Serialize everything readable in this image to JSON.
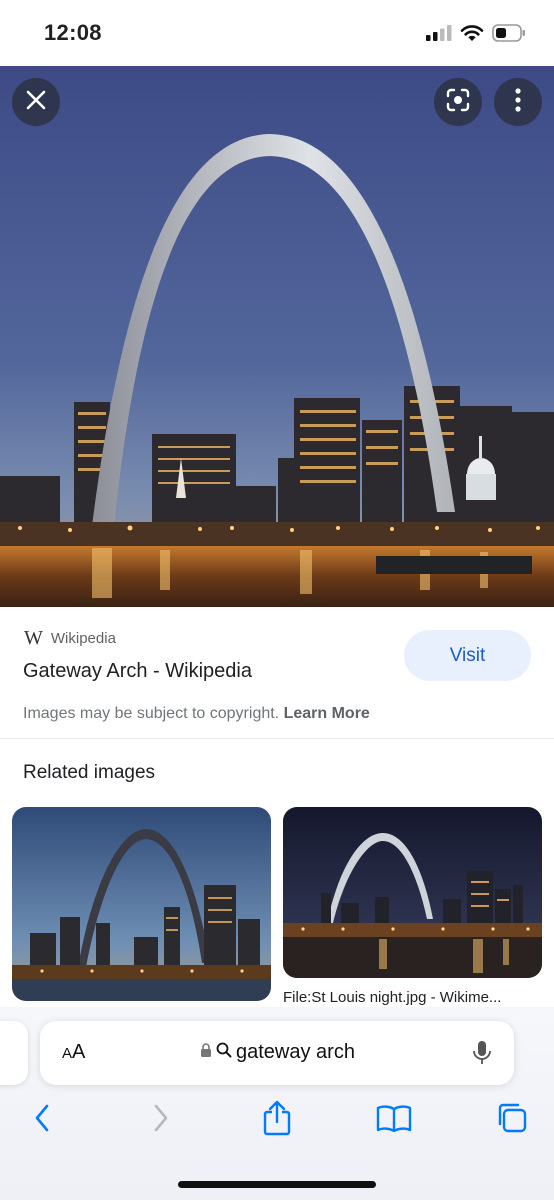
{
  "status_bar": {
    "time": "12:08",
    "icons": [
      "cellular-signal-icon",
      "wifi-icon",
      "battery-icon"
    ]
  },
  "image_viewer": {
    "buttons": [
      "close-icon",
      "lens-icon",
      "more-vert-icon"
    ],
    "source": {
      "logo_text": "W",
      "name": "Wikipedia"
    },
    "title": "Gateway Arch - Wikipedia",
    "visit_label": "Visit",
    "copyright_text": "Images may be subject to copyright.",
    "learn_more": "Learn More"
  },
  "related": {
    "heading": "Related images",
    "items": [
      {
        "caption": ""
      },
      {
        "caption": "File:St Louis night.jpg - Wikime..."
      }
    ]
  },
  "safari": {
    "aa_label_small": "A",
    "aa_label_large": "A",
    "address_text": "gateway arch",
    "toolbar": [
      "back-icon",
      "forward-icon",
      "share-icon",
      "bookmarks-icon",
      "tabs-icon"
    ]
  },
  "colors": {
    "visit_bg": "#e8f0fe",
    "visit_text": "#1a5dc8",
    "ios_blue": "#007aff"
  }
}
